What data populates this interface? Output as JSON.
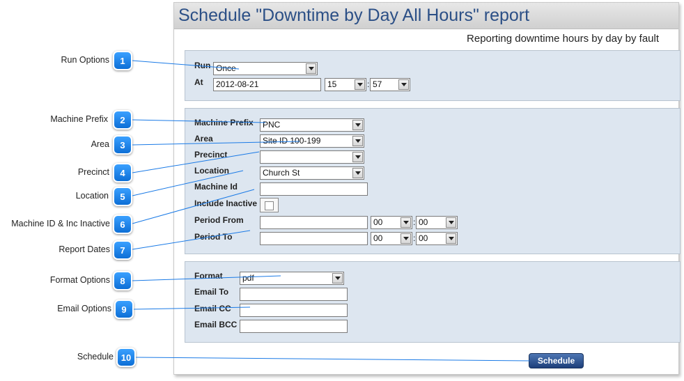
{
  "window": {
    "title": "Schedule \"Downtime by Day All Hours\" report",
    "subtitle": "Reporting downtime hours by day by fault"
  },
  "run": {
    "run_label": "Run",
    "run_value": "Once",
    "at_label": "At",
    "date_value": "2012-08-21",
    "hour_value": "15",
    "minute_value": "57"
  },
  "machine": {
    "prefix_label": "Machine Prefix",
    "prefix_value": "PNC",
    "area_label": "Area",
    "area_value": "Site ID 100-199",
    "precinct_label": "Precinct",
    "precinct_value": "",
    "location_label": "Location",
    "location_value": "Church St",
    "machine_id_label": "Machine Id",
    "machine_id_value": "",
    "include_inactive_label": "Include Inactive",
    "period_from_label": "Period From",
    "period_from_value": "",
    "period_from_hour": "00",
    "period_from_minute": "00",
    "period_to_label": "Period To",
    "period_to_value": "",
    "period_to_hour": "00",
    "period_to_minute": "00"
  },
  "output": {
    "format_label": "Format",
    "format_value": "pdf",
    "email_to_label": "Email To",
    "email_cc_label": "Email CC",
    "email_bcc_label": "Email BCC"
  },
  "schedule_button": "Schedule",
  "colon": ":",
  "callouts": [
    {
      "number": "1",
      "label": "Run Options"
    },
    {
      "number": "2",
      "label": "Machine Prefix"
    },
    {
      "number": "3",
      "label": "Area"
    },
    {
      "number": "4",
      "label": "Precinct"
    },
    {
      "number": "5",
      "label": "Location"
    },
    {
      "number": "6",
      "label": "Machine ID & Inc Inactive"
    },
    {
      "number": "7",
      "label": "Report Dates"
    },
    {
      "number": "8",
      "label": "Format Options"
    },
    {
      "number": "9",
      "label": "Email Options"
    },
    {
      "number": "10",
      "label": "Schedule"
    }
  ],
  "colors": {
    "title": "#2b4f86",
    "panel": "#dde6f0",
    "callout": "#1a82f0",
    "button": "#2a4f8a"
  }
}
